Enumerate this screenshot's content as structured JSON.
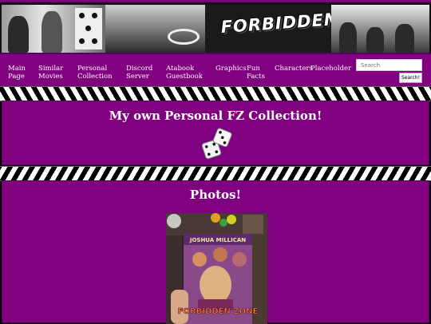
{
  "banner": {
    "logo_text": "FORBIDDEN"
  },
  "nav": {
    "items": [
      {
        "label": "Main Page"
      },
      {
        "label": "Similar Movies"
      },
      {
        "label": "Personal Collection"
      },
      {
        "label": "Discord Server"
      },
      {
        "label": "Atabook Guestbook"
      },
      {
        "label": "Graphics"
      },
      {
        "label": "Fun Facts"
      },
      {
        "label": "Characters"
      },
      {
        "label": "Placeholder"
      }
    ]
  },
  "search": {
    "placeholder": "Search",
    "button_label": "Search!"
  },
  "sections": {
    "collection_title": "My own Personal FZ Collection!",
    "photos_title": "Photos!"
  },
  "photo": {
    "cover_author": "JOSHUA MILLICAN",
    "cover_title": "FORBIDDEN ZONE"
  },
  "colors": {
    "accent": "#800080",
    "text": "#ffffff"
  }
}
